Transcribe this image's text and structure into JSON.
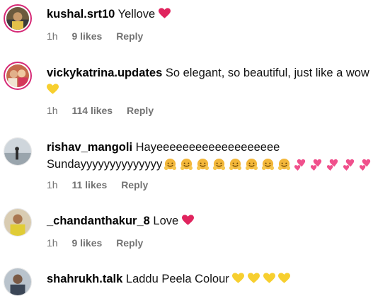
{
  "comments": [
    {
      "username": "kushal.srt10",
      "text": "Yellove",
      "emojis": [
        "red-heart"
      ],
      "time": "1h",
      "likes": "9 likes",
      "reply": "Reply"
    },
    {
      "username": "vickykatrina.updates",
      "text": "So elegant, so beautiful, just like a wow",
      "emojis": [
        "yellow-heart"
      ],
      "time": "1h",
      "likes": "114 likes",
      "reply": "Reply"
    },
    {
      "username": "rishav_mangoli",
      "text": "Hayeeeeeeeeeeeeeeeeeee",
      "text2": "Sundayyyyyyyyyyyyyy",
      "emojis": [
        "hugging-face",
        "hugging-face",
        "hugging-face",
        "hugging-face",
        "hugging-face",
        "hugging-face",
        "hugging-face",
        "hugging-face",
        "two-hearts",
        "two-hearts",
        "two-hearts",
        "two-hearts",
        "two-hearts"
      ],
      "time": "1h",
      "likes": "11 likes",
      "reply": "Reply"
    },
    {
      "username": "_chandanthakur_8",
      "text": "Love",
      "emojis": [
        "red-heart"
      ],
      "time": "1h",
      "likes": "9 likes",
      "reply": "Reply"
    },
    {
      "username": "shahrukh.talk",
      "text": "Laddu Peela Colour",
      "emojis": [
        "yellow-heart",
        "yellow-heart",
        "yellow-heart",
        "yellow-heart"
      ]
    }
  ],
  "colors": {
    "red_heart": "#e0245e",
    "yellow_heart": "#f7cf2f",
    "pink_heart": "#f0508c",
    "hug": "#f3b73a",
    "meta": "#737373",
    "story_ring": "#d62976"
  }
}
